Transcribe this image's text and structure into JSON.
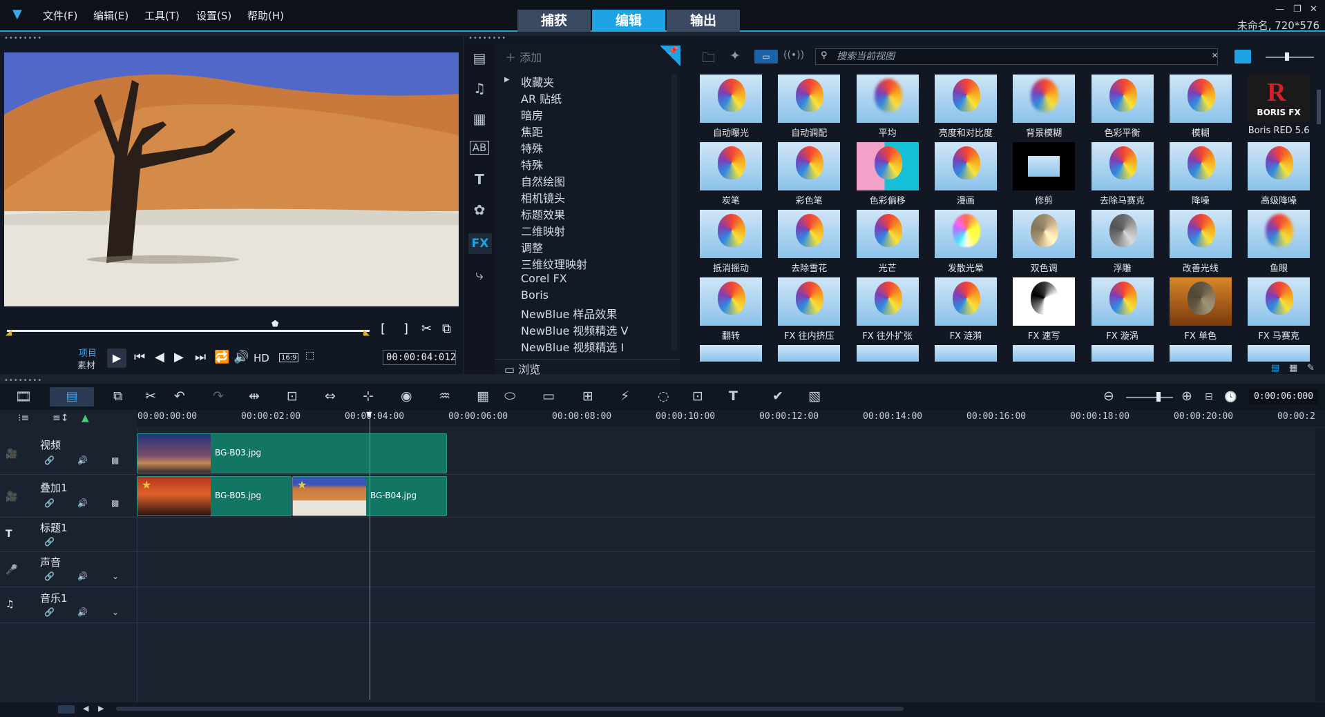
{
  "menu": {
    "items": [
      "文件(F)",
      "编辑(E)",
      "工具(T)",
      "设置(S)",
      "帮助(H)"
    ]
  },
  "tabs": [
    "捕获",
    "编辑",
    "输出"
  ],
  "project_info": "未命名, 720*576",
  "player": {
    "mode_project": "项目",
    "mode_clip": "素材",
    "hd": "HD",
    "aspect": "16:9",
    "timecode": "00:00:04:012"
  },
  "library": {
    "add_label": "添加",
    "categories": [
      "收藏夹",
      "AR 贴纸",
      "暗房",
      "焦距",
      "特殊",
      "特殊",
      "自然绘图",
      "相机镜头",
      "标题效果",
      "二维映射",
      "调整",
      "三维纹理映射",
      "Corel FX",
      "Boris",
      "NewBlue 样品效果",
      "NewBlue 视频精选 V",
      "NewBlue 视频精选 I"
    ],
    "browse_label": "浏览"
  },
  "browser": {
    "search_placeholder": "搜索当前视图",
    "effects": [
      "自动曝光",
      "自动调配",
      "平均",
      "亮度和对比度",
      "背景模糊",
      "色彩平衡",
      "模糊",
      "Boris RED 5.6",
      "炭笔",
      "彩色笔",
      "色彩偏移",
      "漫画",
      "修剪",
      "去除马赛克",
      "降噪",
      "高级降噪",
      "抵消摇动",
      "去除雪花",
      "光芒",
      "发散光晕",
      "双色调",
      "浮雕",
      "改善光线",
      "鱼眼",
      "翻转",
      "FX 往内挤压",
      "FX 往外扩张",
      "FX 涟漪",
      "FX 速写",
      "FX 漩涡",
      "FX 单色",
      "FX 马赛克"
    ],
    "boris_logo": "BORIS FX"
  },
  "timeline": {
    "zoom_timecode": "0:00:06:000",
    "ruler": [
      "00:00:00:00",
      "00:00:02:00",
      "00:00:04:00",
      "00:00:06:00",
      "00:00:08:00",
      "00:00:10:00",
      "00:00:12:00",
      "00:00:14:00",
      "00:00:16:00",
      "00:00:18:00",
      "00:00:20:00",
      "00:00:2"
    ],
    "tracks": [
      "视频",
      "叠加1",
      "标题1",
      "声音",
      "音乐1"
    ],
    "clips": {
      "video": "BG-B03.jpg",
      "overlay_a": "BG-B05.jpg",
      "overlay_b": "BG-B04.jpg"
    }
  },
  "colors": {
    "accent": "#1ea3e5",
    "clip": "#137563"
  }
}
